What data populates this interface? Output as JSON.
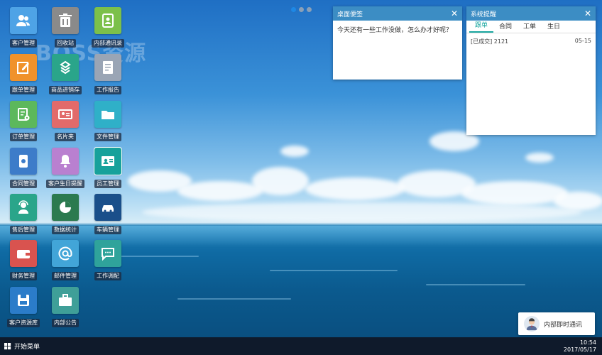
{
  "watermark": "BOSS资源",
  "desktop_icons": [
    {
      "label": "客户管理",
      "color": "#4ea3e6"
    },
    {
      "label": "回收站",
      "color": "#8a8a8a"
    },
    {
      "label": "内部通讯录",
      "color": "#7cc04a"
    },
    {
      "label": "跟单管理",
      "color": "#f0922b"
    },
    {
      "label": "商品进销存",
      "color": "#2aa58a"
    },
    {
      "label": "工作报告",
      "color": "#9aa5b5"
    },
    {
      "label": "订单管理",
      "color": "#5cb85c"
    },
    {
      "label": "名片夹",
      "color": "#e26a6a"
    },
    {
      "label": "文件管理",
      "color": "#2fb0c8"
    },
    {
      "label": "合同管理",
      "color": "#3d7cc9"
    },
    {
      "label": "客户生日提醒",
      "color": "#b980d0"
    },
    {
      "label": "员工管理",
      "color": "#17a19b"
    },
    {
      "label": "售后管理",
      "color": "#2aa58a"
    },
    {
      "label": "数据统计",
      "color": "#2b7a4f"
    },
    {
      "label": "车辆管理",
      "color": "#1a4f8a"
    },
    {
      "label": "财务管理",
      "color": "#d9534f"
    },
    {
      "label": "邮件管理",
      "color": "#42a5d8"
    },
    {
      "label": "工作调配",
      "color": "#2fa39b"
    },
    {
      "label": "客户资源库",
      "color": "#2b7cc9"
    },
    {
      "label": "内部公告",
      "color": "#3f9f98"
    }
  ],
  "note_window": {
    "title": "桌面便签",
    "close": "✕",
    "text": "今天还有一些工作没做，怎么办才好呢？"
  },
  "reminder_window": {
    "title": "系统提醒",
    "close": "✕",
    "tabs": [
      "跟单",
      "合同",
      "工单",
      "生日"
    ],
    "rows": [
      {
        "text": "[已成交] 2121",
        "date": "05-15"
      }
    ]
  },
  "im_button": {
    "label": "内部即时通讯"
  },
  "taskbar": {
    "start_label": "开始菜单",
    "time": "10:54",
    "date": "2017/05/17"
  }
}
